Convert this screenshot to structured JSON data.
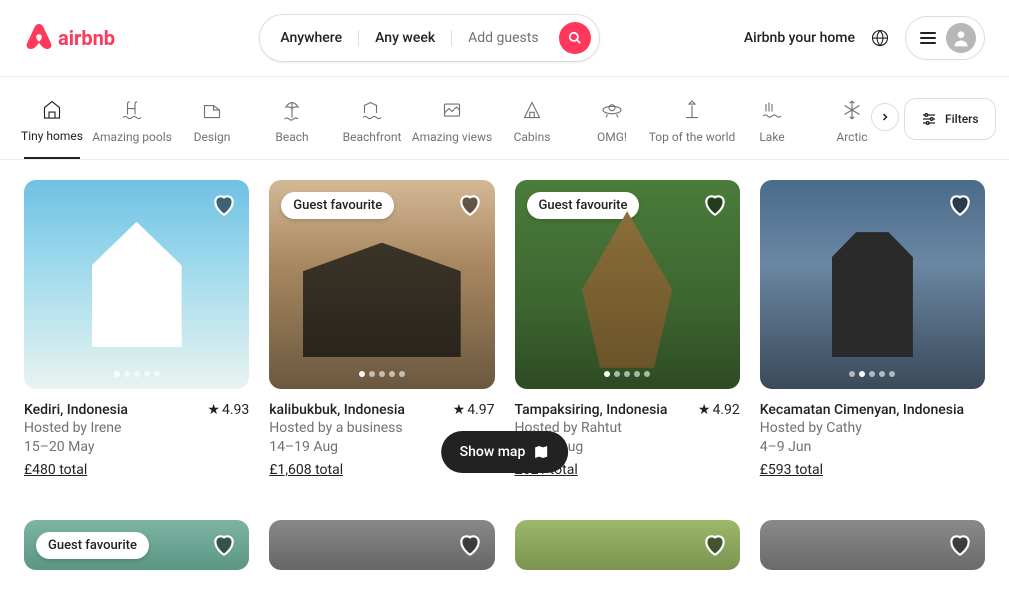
{
  "header": {
    "brand": "airbnb",
    "search": {
      "anywhere": "Anywhere",
      "anyweek": "Any week",
      "guests": "Add guests"
    },
    "host_link": "Airbnb your home"
  },
  "categories": [
    {
      "label": "Tiny homes",
      "active": true
    },
    {
      "label": "Amazing pools"
    },
    {
      "label": "Design"
    },
    {
      "label": "Beach"
    },
    {
      "label": "Beachfront"
    },
    {
      "label": "Amazing views"
    },
    {
      "label": "Cabins"
    },
    {
      "label": "OMG!"
    },
    {
      "label": "Top of the world"
    },
    {
      "label": "Lake"
    },
    {
      "label": "Arctic"
    }
  ],
  "filters_label": "Filters",
  "guest_favourite": "Guest favourite",
  "listings": [
    {
      "title": "Kediri, Indonesia",
      "rating": "4.93",
      "host": "Hosted by Irene",
      "dates": "15–20 May",
      "price": "£480 total",
      "fav": false
    },
    {
      "title": "kalibukbuk, Indonesia",
      "rating": "4.97",
      "host": "Hosted by a business",
      "dates": "14–19 Aug",
      "price": "£1,608 total",
      "fav": true
    },
    {
      "title": "Tampaksiring, Indonesia",
      "rating": "4.92",
      "host": "Hosted by Rahtut",
      "dates": "25–30 Aug",
      "price": "£621 total",
      "fav": true
    },
    {
      "title": "Kecamatan Cimenyan, Indonesia",
      "rating": "",
      "host": "Hosted by Cathy",
      "dates": "4–9 Jun",
      "price": "£593 total",
      "fav": false
    }
  ],
  "listings_row2": [
    {
      "fav": true
    },
    {
      "fav": false
    },
    {
      "fav": false
    },
    {
      "fav": false
    }
  ],
  "show_map": "Show map"
}
